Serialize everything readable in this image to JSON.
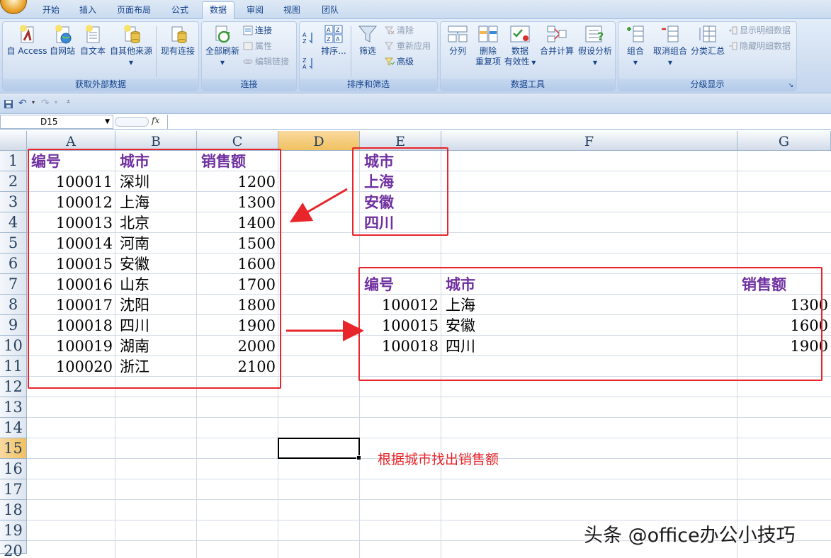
{
  "ribbon": {
    "tabs": [
      "开始",
      "插入",
      "页面布局",
      "公式",
      "数据",
      "审阅",
      "视图",
      "团队"
    ],
    "active_tab": "数据",
    "groups": {
      "external": {
        "label": "获取外部数据",
        "access": "自 Access",
        "web": "自网站",
        "text": "自文本",
        "other": "自其他来源",
        "existing": "现有连接"
      },
      "connections": {
        "label": "连接",
        "refresh_all": "全部刷新",
        "connect": "连接",
        "properties": "属性",
        "edit_links": "编辑链接"
      },
      "sort_filter": {
        "label": "排序和筛选",
        "sort": "排序...",
        "filter": "筛选",
        "clear": "清除",
        "reapply": "重新应用",
        "advanced": "高级"
      },
      "data_tools": {
        "label": "数据工具",
        "text_to_columns": "分列",
        "remove_dup_1": "删除",
        "remove_dup_2": "重复项",
        "validation_1": "数据",
        "validation_2": "有效性",
        "consolidate": "合并计算",
        "whatif": "假设分析"
      },
      "outline": {
        "label": "分级显示",
        "group": "组合",
        "ungroup": "取消组合",
        "subtotal": "分类汇总",
        "show_detail": "显示明细数据",
        "hide_detail": "隐藏明细数据"
      }
    }
  },
  "formula_bar": {
    "name_box": "D15",
    "fx": "fx",
    "formula": ""
  },
  "columns": [
    "A",
    "B",
    "C",
    "D",
    "E",
    "F",
    "G"
  ],
  "rows": [
    "1",
    "2",
    "3",
    "4",
    "5",
    "6",
    "7",
    "8",
    "9",
    "10",
    "11",
    "12",
    "13",
    "14",
    "15",
    "16",
    "17",
    "18",
    "19",
    "20"
  ],
  "selected": {
    "column": "D",
    "row": "15"
  },
  "source_table": {
    "headers": [
      "编号",
      "城市",
      "销售额"
    ],
    "rows": [
      [
        "100011",
        "深圳",
        "1200"
      ],
      [
        "100012",
        "上海",
        "1300"
      ],
      [
        "100013",
        "北京",
        "1400"
      ],
      [
        "100014",
        "河南",
        "1500"
      ],
      [
        "100015",
        "安徽",
        "1600"
      ],
      [
        "100016",
        "山东",
        "1700"
      ],
      [
        "100017",
        "沈阳",
        "1800"
      ],
      [
        "100018",
        "四川",
        "1900"
      ],
      [
        "100019",
        "湖南",
        "2000"
      ],
      [
        "100020",
        "浙江",
        "2100"
      ]
    ]
  },
  "criteria": {
    "header": "城市",
    "values": [
      "上海",
      "安徽",
      "四川"
    ]
  },
  "result_table": {
    "headers": [
      "编号",
      "城市",
      "销售额"
    ],
    "rows": [
      [
        "100012",
        "上海",
        "1300"
      ],
      [
        "100015",
        "安徽",
        "1600"
      ],
      [
        "100018",
        "四川",
        "1900"
      ]
    ]
  },
  "annotation": "根据城市找出销售额",
  "watermark": "头条 @office办公小技巧",
  "colors": {
    "header_text": "#7030a0",
    "highlight_box": "#e8252a",
    "ribbon_text": "#15428b"
  }
}
